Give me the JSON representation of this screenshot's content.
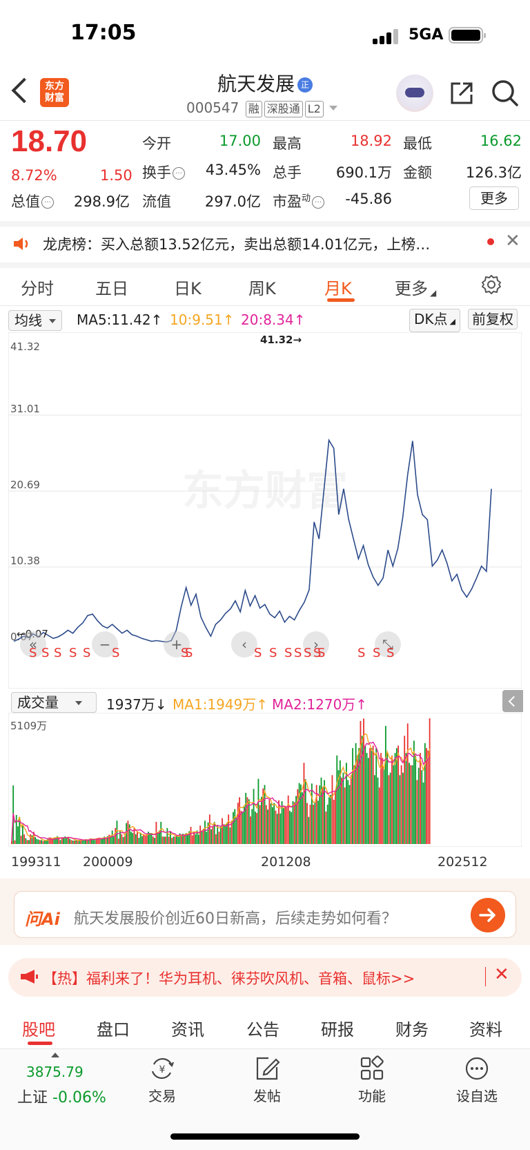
{
  "status_bar": {
    "time": "17:05",
    "network": "5GA"
  },
  "header": {
    "logo_text": "东方财富",
    "title": "航天发展",
    "title_badge": "正",
    "code": "000547",
    "tags": [
      "融",
      "深股通",
      "L2"
    ]
  },
  "quote": {
    "price": "18.70",
    "change_pct": "8.72%",
    "change_abs": "1.50",
    "fields": {
      "open": {
        "label": "今开",
        "value": "17.00"
      },
      "high": {
        "label": "最高",
        "value": "18.92"
      },
      "low": {
        "label": "最低",
        "value": "16.62"
      },
      "turnover": {
        "label": "换手",
        "value": "43.45%"
      },
      "volume": {
        "label": "总手",
        "value": "690.1万"
      },
      "amount": {
        "label": "金额",
        "value": "126.3亿"
      },
      "total_mcap": {
        "label": "总值",
        "value": "298.9亿"
      },
      "float_mcap": {
        "label": "流值",
        "value": "297.0亿"
      },
      "pe": {
        "label": "市盈",
        "sup": "动",
        "value": "-45.86"
      }
    },
    "more_label": "更多"
  },
  "news": {
    "text": "龙虎榜：买入总额13.52亿元，卖出总额14.01亿元，上榜…",
    "close": "✕"
  },
  "period_tabs": {
    "items": [
      "分时",
      "五日",
      "日K",
      "周K",
      "月K",
      "更多"
    ],
    "active": "月K"
  },
  "ma_row": {
    "select": "均线",
    "ma5": "MA5:11.42↑",
    "ma10": "10:9.51↑",
    "ma20": "20:8.34↑",
    "dk": "DK点",
    "adjust": "前复权",
    "colors": {
      "ma5": "#222222",
      "ma10": "#f5a623",
      "ma20": "#e0249a"
    }
  },
  "watermark": "东方财富",
  "chart_data": [
    {
      "type": "line",
      "title": "",
      "y_tick_labels": [
        "41.32",
        "31.01",
        "20.69",
        "10.38",
        "0.07"
      ],
      "ylim": [
        0.07,
        41.32
      ],
      "max_annotation": "41.32→",
      "min_annotation": "←0.07",
      "signal_labels": [
        "S",
        "S",
        "S",
        "S",
        "S",
        "S",
        "S",
        "S",
        "S",
        "S",
        "S",
        "S",
        "S",
        "S",
        "S",
        "S",
        "S",
        "S"
      ],
      "x_tick_labels": [
        "199311",
        "200009",
        "201208",
        "202512"
      ],
      "series": [
        {
          "values": [
            0.3,
            0.6,
            1.0,
            0.8,
            1.3,
            0.9,
            1.5,
            1.1,
            0.7,
            0.9,
            1.3,
            1.8,
            1.4,
            2.2,
            2.8,
            3.8,
            4.0,
            3.1,
            2.4,
            2.1,
            2.6,
            2.0,
            1.4,
            1.8,
            1.2,
            1.0,
            0.7,
            0.5,
            0.3,
            0.4,
            0.3,
            0.2,
            0.4,
            1.8,
            5.0,
            7.6,
            5.2,
            6.7,
            3.6,
            2.2,
            1.0,
            2.6,
            3.2,
            4.1,
            4.7,
            5.8,
            4.3,
            7.2,
            5.1,
            6.5,
            4.8,
            5.3,
            4.0,
            3.5,
            4.4,
            2.9,
            3.7,
            3.2,
            4.5,
            5.6,
            7.3,
            16.5,
            14.2,
            20.8,
            27.6,
            26.5,
            17.5,
            21.0,
            16.9,
            14.2,
            11.5,
            13.3,
            10.7,
            9.0,
            7.9,
            8.9,
            12.7,
            10.5,
            12.9,
            17.1,
            22.9,
            27.5,
            20.2,
            17.5,
            16.8,
            10.5,
            11.3,
            12.7,
            10.9,
            8.5,
            9.4,
            7.3,
            6.3,
            7.4,
            8.9,
            10.5,
            9.8,
            21.0
          ]
        }
      ]
    },
    {
      "type": "bar",
      "title": "",
      "select": "成交量",
      "current_label": "1937万↓",
      "ma1_label": "MA1:1949万↑",
      "ma2_label": "MA2:1270万↑",
      "y_tick_labels": [
        "5109万"
      ],
      "ylim": [
        0,
        5109
      ],
      "unit": "万",
      "values": [
        120,
        2380,
        150,
        1180,
        720,
        1100,
        340,
        740,
        390,
        240,
        160,
        160,
        400,
        350,
        500,
        280,
        210,
        180,
        160,
        160,
        120,
        150,
        130,
        240,
        270,
        260,
        230,
        250,
        270,
        320,
        250,
        160,
        270,
        250,
        310,
        280,
        290,
        210,
        160,
        140,
        140,
        170,
        130,
        160,
        190,
        150,
        180,
        200,
        150,
        180,
        230,
        220,
        200,
        160,
        240,
        250,
        260,
        230,
        230,
        300,
        250,
        320,
        380,
        350,
        550,
        300,
        650,
        950,
        220,
        540,
        400,
        280,
        320,
        850,
        950,
        800,
        500,
        450,
        650,
        400,
        500,
        250,
        450,
        320,
        400,
        350,
        350,
        500,
        450,
        450,
        300,
        250,
        900,
        450,
        550,
        900,
        300,
        300,
        300,
        650,
        300,
        500,
        250,
        300,
        300,
        350,
        300,
        430,
        350,
        420,
        400,
        450,
        400,
        520,
        700,
        350,
        500,
        400,
        550,
        380,
        750,
        550,
        620,
        950,
        500,
        880,
        1200,
        600,
        700,
        900,
        400,
        780,
        500,
        700,
        1050,
        800,
        800,
        850,
        1200,
        680,
        950,
        1300,
        1420,
        1100,
        1680,
        1900,
        1350,
        1320,
        1520,
        2080,
        1900,
        1820,
        1120,
        1420,
        2240,
        1320,
        1260,
        2650,
        1580,
        1920,
        2260,
        2400,
        1580,
        1400,
        1800,
        1650,
        1500,
        1670,
        1360,
        1230,
        1780,
        1240,
        1740,
        1460,
        1500,
        1480,
        1970,
        1350,
        1300,
        1740,
        1700,
        1950,
        2230,
        2480,
        2420,
        2100,
        3300,
        2640,
        1670,
        1100,
        1600,
        2460,
        1600,
        1700,
        2400,
        1760,
        2380,
        2700,
        2330,
        2600,
        1320,
        1600,
        1900,
        2000,
        2800,
        1800,
        2200,
        3600,
        3000,
        3400,
        2700,
        2900,
        2300,
        3300,
        2600,
        2400,
        2800,
        3900,
        3200,
        4100,
        3600,
        3900,
        5000,
        4400,
        5100,
        4000,
        3700,
        3500,
        3900,
        3900,
        4000,
        2800,
        3900,
        2700,
        2300,
        3700,
        3500,
        3100,
        4800,
        3700,
        2800,
        2900,
        3600,
        3200,
        3700,
        3900,
        4000,
        2800,
        3200,
        2900,
        4400,
        3700,
        4900,
        3300,
        3200,
        3200,
        4200,
        3600,
        2600,
        3100,
        3700,
        3000,
        2500,
        4100,
        3900,
        3800,
        5109
      ],
      "colors": {
        "up": "#e8312f",
        "down": "#0a9a2c",
        "ma1": "#f5a623",
        "ma2": "#e0249a"
      }
    }
  ],
  "ai_bar": {
    "logo": "问Ai",
    "prompt": "航天发展股价创近60日新高，后续走势如何看？"
  },
  "promo": {
    "text": "【热】福利来了！华为耳机、徕芬吹风机、音箱、鼠标>>",
    "close": "✕"
  },
  "bottom_tabs": {
    "items": [
      "股吧",
      "盘口",
      "资讯",
      "公告",
      "研报",
      "财务",
      "资料"
    ],
    "active": "股吧"
  },
  "toolbar": {
    "index_value": "3875.79",
    "index_name": "上证",
    "index_change": "-0.06%",
    "items": [
      {
        "label": "交易",
        "icon": "trade-icon"
      },
      {
        "label": "发帖",
        "icon": "post-icon"
      },
      {
        "label": "功能",
        "icon": "grid-icon"
      },
      {
        "label": "设自选",
        "icon": "more-dots-icon"
      }
    ]
  }
}
